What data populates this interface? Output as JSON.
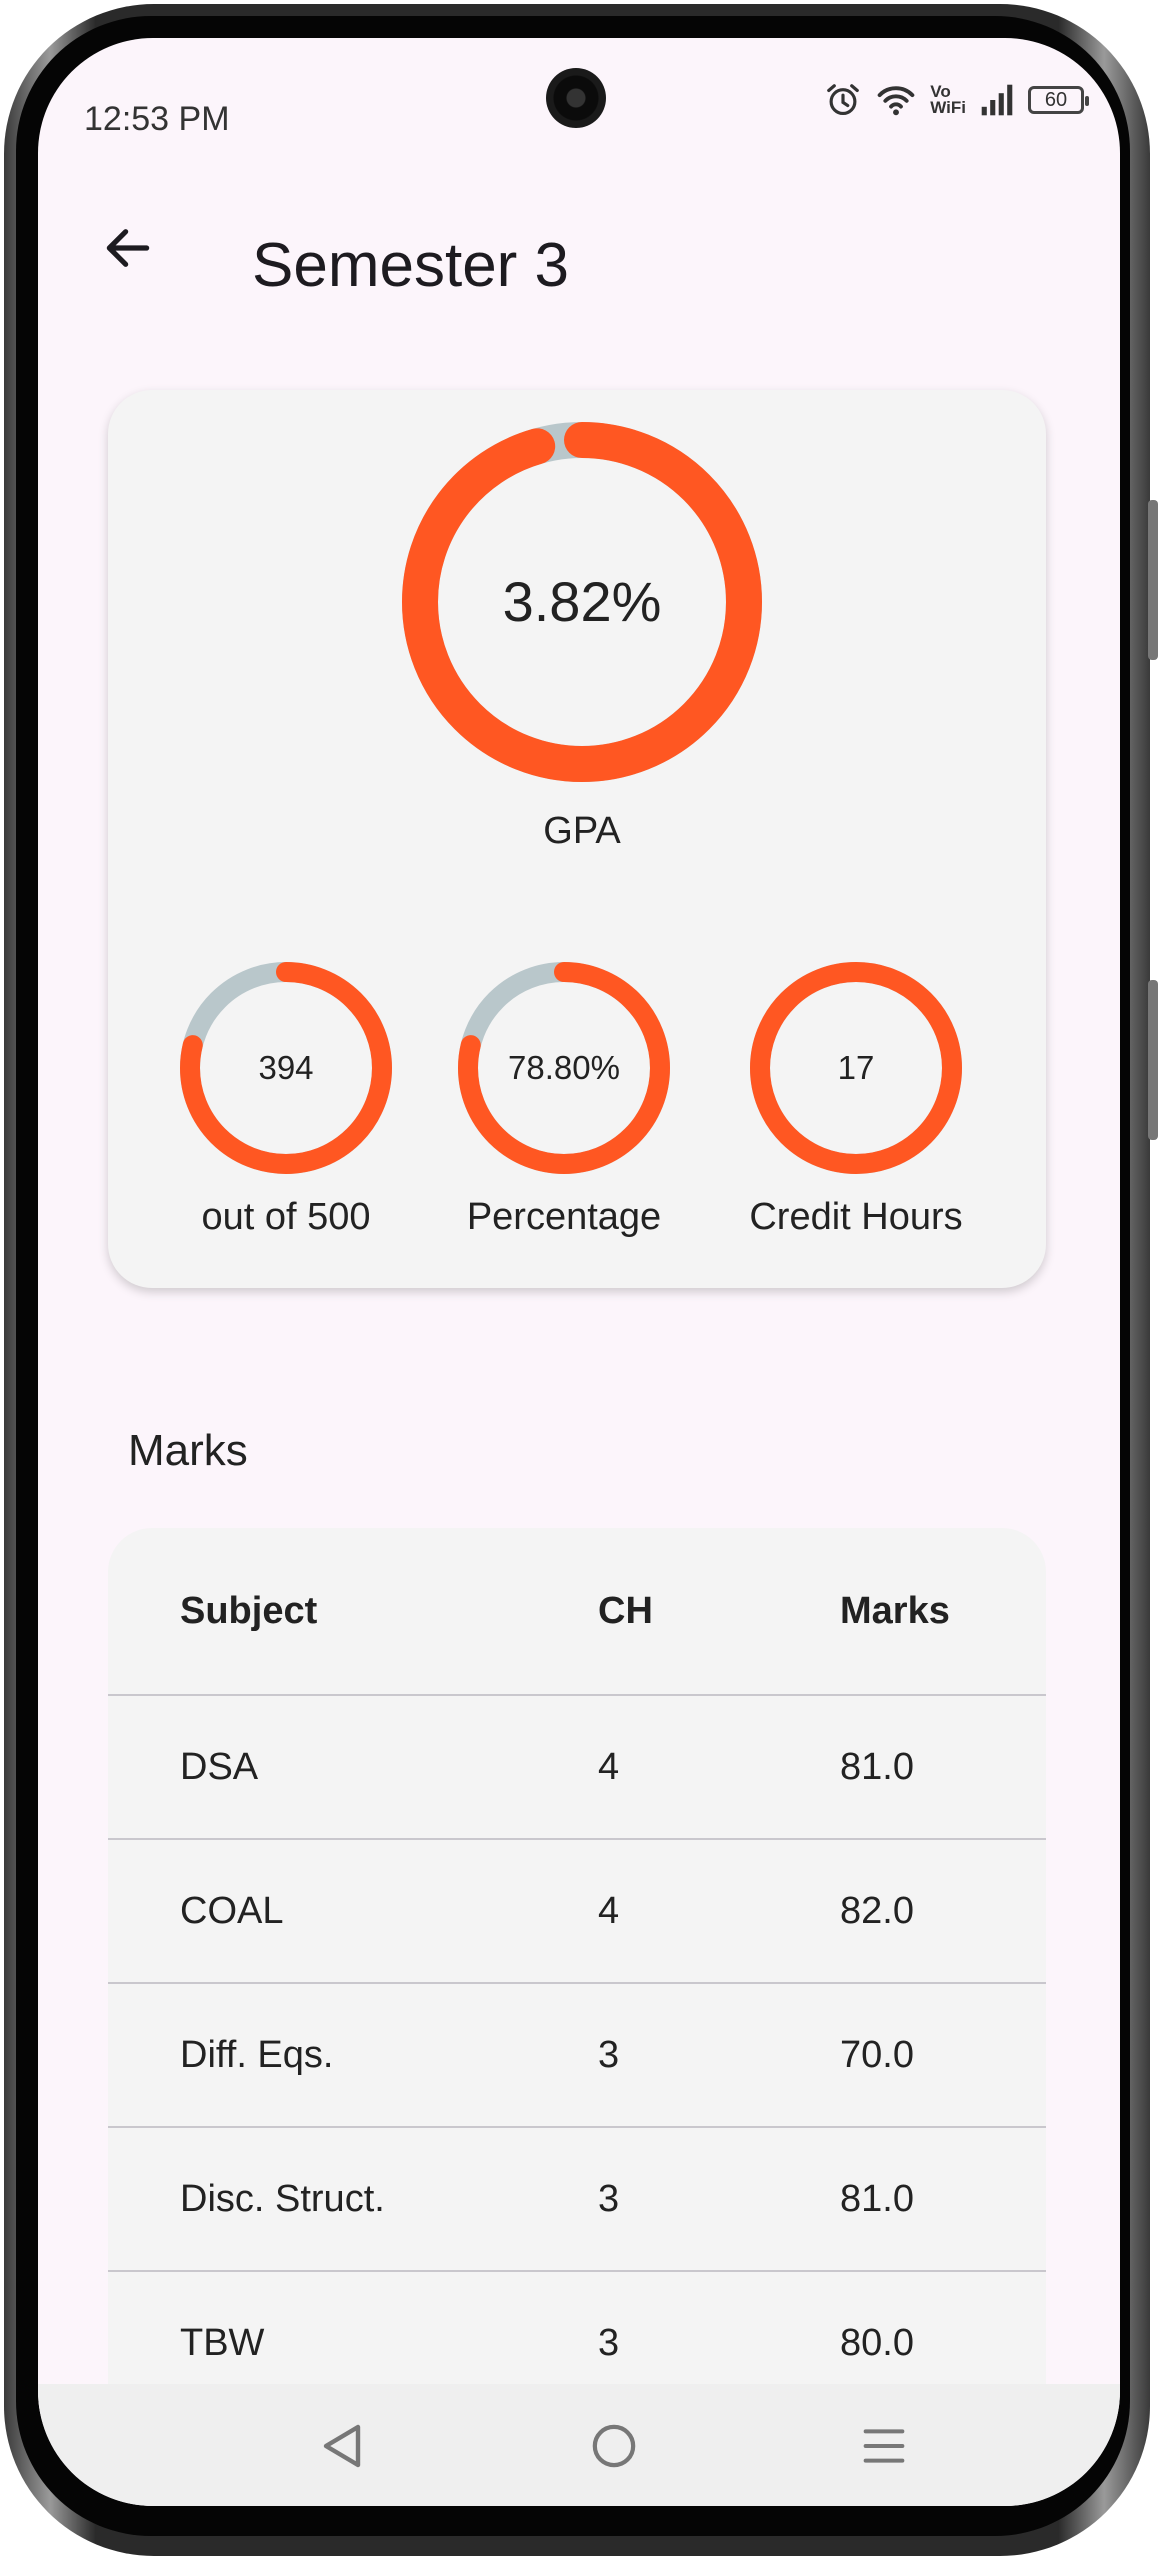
{
  "status_bar": {
    "time": "12:53 PM",
    "volte_top": "Vo",
    "volte_bottom": "WiFi",
    "battery": "60"
  },
  "app_bar": {
    "title": "Semester 3"
  },
  "summary": {
    "gpa": {
      "value": "3.82%",
      "label": "GPA",
      "progress": 0.955
    },
    "stats": [
      {
        "value": "394",
        "label": "out of 500",
        "progress": 0.788
      },
      {
        "value": "78.80%",
        "label": "Percentage",
        "progress": 0.788
      },
      {
        "value": "17",
        "label": "Credit Hours",
        "progress": 1.0
      }
    ]
  },
  "marks_section": {
    "title": "Marks",
    "headers": {
      "subject": "Subject",
      "ch": "CH",
      "marks": "Marks"
    },
    "rows": [
      {
        "subject": "DSA",
        "ch": "4",
        "marks": "81.0"
      },
      {
        "subject": "COAL",
        "ch": "4",
        "marks": "82.0"
      },
      {
        "subject": "Diff. Eqs.",
        "ch": "3",
        "marks": "70.0"
      },
      {
        "subject": "Disc. Struct.",
        "ch": "3",
        "marks": "81.0"
      },
      {
        "subject": "TBW",
        "ch": "3",
        "marks": "80.0"
      }
    ]
  },
  "colors": {
    "accent": "#ff5722",
    "track": "#b9c7cb",
    "card": "#f4f4f4",
    "background": "#fcf5fb"
  },
  "nav_bar": {
    "icons": [
      "back-triangle-icon",
      "home-circle-icon",
      "menu-lines-icon"
    ]
  }
}
